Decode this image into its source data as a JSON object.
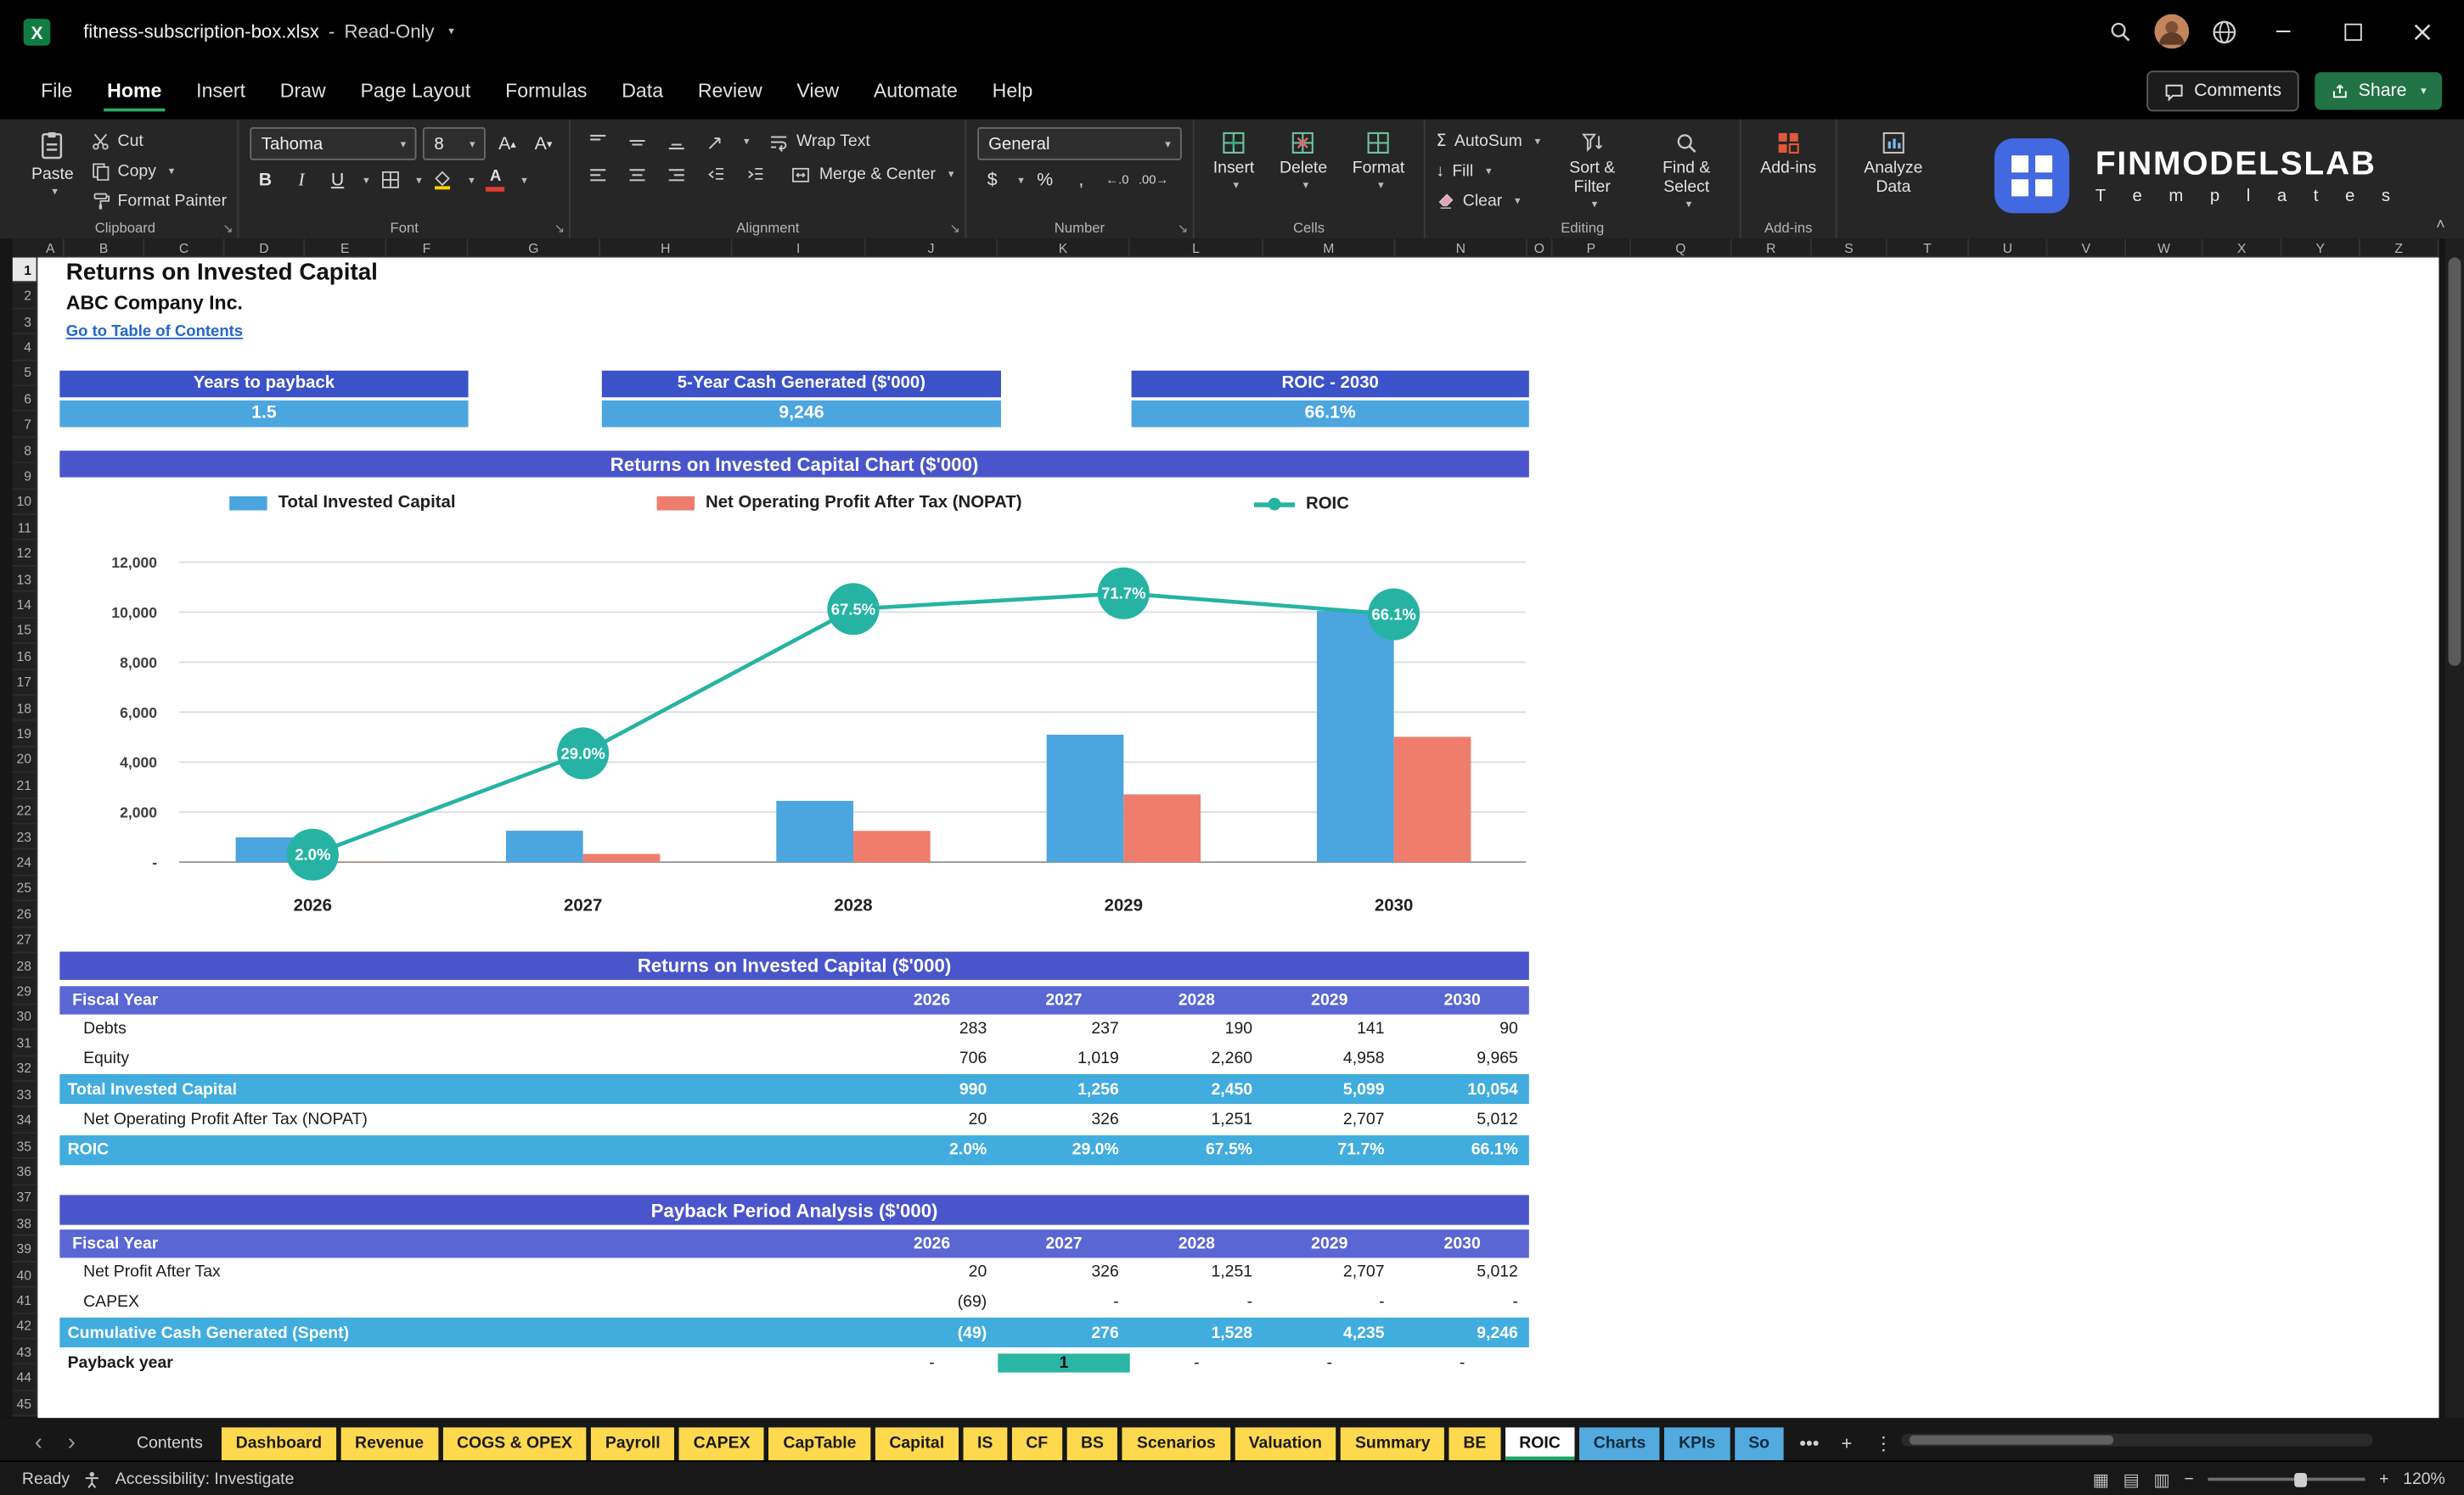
{
  "titlebar": {
    "file_name": "fitness-subscription-box.xlsx",
    "separator": "-",
    "mode": "Read-Only"
  },
  "menu": {
    "items": [
      "File",
      "Home",
      "Insert",
      "Draw",
      "Page Layout",
      "Formulas",
      "Data",
      "Review",
      "View",
      "Automate",
      "Help"
    ],
    "active": "Home",
    "comments_label": "Comments",
    "share_label": "Share"
  },
  "ribbon": {
    "clipboard": {
      "label": "Clipboard",
      "paste": "Paste",
      "cut": "Cut",
      "copy": "Copy",
      "format_painter": "Format Painter"
    },
    "font": {
      "label": "Font",
      "font_name": "Tahoma",
      "font_size": "8"
    },
    "alignment": {
      "label": "Alignment",
      "wrap_text": "Wrap Text",
      "merge_center": "Merge & Center"
    },
    "number": {
      "label": "Number",
      "format": "General",
      "dollar": "$",
      "percent": "%",
      "comma": ",",
      "inc_dec": "←.0",
      "dec_dec": ".00→"
    },
    "cells": {
      "label": "Cells",
      "insert": "Insert",
      "delete": "Delete",
      "format": "Format"
    },
    "editing": {
      "label": "Editing",
      "autosum": "AutoSum",
      "fill": "Fill",
      "clear": "Clear",
      "sort_filter": "Sort & Filter",
      "find_select": "Find & Select"
    },
    "addins": {
      "label": "Add-ins",
      "addins": "Add-ins",
      "analyze": "Analyze Data"
    },
    "brand": {
      "line1": "FINMODELSLAB",
      "line2": "T e m p l a t e s"
    }
  },
  "sheet": {
    "columns": [
      "A",
      "B",
      "C",
      "D",
      "E",
      "F",
      "G",
      "H",
      "I",
      "J",
      "K",
      "L",
      "M",
      "N",
      "O",
      "P",
      "Q",
      "R",
      "S",
      "T",
      "U",
      "V",
      "W",
      "X",
      "Y",
      "Z"
    ],
    "rows_visible": 45,
    "title": "Returns on Invested Capital",
    "company": "ABC Company Inc.",
    "link": "Go to Table of Contents",
    "chart_title": "Returns on Invested Capital Chart ($'000)",
    "kpis": [
      {
        "label": "Years to payback",
        "value": "1.5"
      },
      {
        "label": "5-Year Cash Generated ($'000)",
        "value": "9,246"
      },
      {
        "label": "ROIC - 2030",
        "value": "66.1%"
      }
    ]
  },
  "chart_data": {
    "type": "bar",
    "title": "Returns on Invested Capital Chart ($'000)",
    "categories": [
      "2026",
      "2027",
      "2028",
      "2029",
      "2030"
    ],
    "series": [
      {
        "name": "Total Invested Capital",
        "type": "bar",
        "color": "#4BA5DF",
        "values": [
          990,
          1256,
          2450,
          5099,
          10054
        ]
      },
      {
        "name": "Net Operating Profit After Tax (NOPAT)",
        "type": "bar",
        "color": "#EE7D6E",
        "values": [
          20,
          326,
          1251,
          2707,
          5012
        ]
      },
      {
        "name": "ROIC",
        "type": "line",
        "color": "#26B3A4",
        "values": [
          2.0,
          29.0,
          67.5,
          71.7,
          66.1
        ],
        "labels": [
          "2.0%",
          "29.0%",
          "67.5%",
          "71.7%",
          "66.1%"
        ]
      }
    ],
    "y_ticks": [
      "12,000",
      "10,000",
      "8,000",
      "6,000",
      "4,000",
      "2,000",
      "-"
    ],
    "value_axis_max": 12000,
    "pct_axis_max": 80,
    "ylim": [
      0,
      12000
    ],
    "grid": true,
    "legend_position": "top"
  },
  "roic_table": {
    "title": "Returns on Invested Capital ($'000)",
    "header": {
      "label": "Fiscal Year",
      "years": [
        "2026",
        "2027",
        "2028",
        "2029",
        "2030"
      ]
    },
    "rows": [
      {
        "label": "Debts",
        "indent": true,
        "style": "plain",
        "values": [
          "283",
          "237",
          "190",
          "141",
          "90"
        ]
      },
      {
        "label": "Equity",
        "indent": true,
        "style": "plain",
        "values": [
          "706",
          "1,019",
          "2,260",
          "4,958",
          "9,965"
        ]
      },
      {
        "label": "Total Invested Capital",
        "indent": false,
        "style": "highlight",
        "values": [
          "990",
          "1,256",
          "2,450",
          "5,099",
          "10,054"
        ]
      },
      {
        "label": "Net Operating Profit After Tax (NOPAT)",
        "indent": true,
        "style": "plain",
        "values": [
          "20",
          "326",
          "1,251",
          "2,707",
          "5,012"
        ]
      },
      {
        "label": "ROIC",
        "indent": false,
        "style": "highlight",
        "values": [
          "2.0%",
          "29.0%",
          "67.5%",
          "71.7%",
          "66.1%"
        ]
      }
    ]
  },
  "payback_table": {
    "title": "Payback Period Analysis ($'000)",
    "header": {
      "label": "Fiscal Year",
      "years": [
        "2026",
        "2027",
        "2028",
        "2029",
        "2030"
      ]
    },
    "rows": [
      {
        "label": "Net Profit After Tax",
        "indent": true,
        "style": "plain",
        "values": [
          "20",
          "326",
          "1,251",
          "2,707",
          "5,012"
        ]
      },
      {
        "label": "CAPEX",
        "indent": true,
        "style": "plain",
        "values": [
          "(69)",
          "-",
          "-",
          "-",
          "-"
        ]
      },
      {
        "label": "Cumulative Cash Generated (Spent)",
        "indent": false,
        "style": "highlight",
        "values": [
          "(49)",
          "276",
          "1,528",
          "4,235",
          "9,246"
        ]
      },
      {
        "label": "Payback year",
        "indent": false,
        "style": "payback",
        "highlight_col": 1,
        "values": [
          "-",
          "1",
          "-",
          "-",
          "-"
        ]
      }
    ]
  },
  "tabs": {
    "items": [
      {
        "label": "Contents",
        "type": "plain"
      },
      {
        "label": "Dashboard",
        "type": "yellow"
      },
      {
        "label": "Revenue",
        "type": "yellow"
      },
      {
        "label": "COGS & OPEX",
        "type": "yellow"
      },
      {
        "label": "Payroll",
        "type": "yellow"
      },
      {
        "label": "CAPEX",
        "type": "yellow"
      },
      {
        "label": "CapTable",
        "type": "yellow"
      },
      {
        "label": "Capital",
        "type": "yellow"
      },
      {
        "label": "IS",
        "type": "yellow"
      },
      {
        "label": "CF",
        "type": "yellow"
      },
      {
        "label": "BS",
        "type": "yellow"
      },
      {
        "label": "Scenarios",
        "type": "yellow"
      },
      {
        "label": "Valuation",
        "type": "yellow"
      },
      {
        "label": "Summary",
        "type": "yellow"
      },
      {
        "label": "BE",
        "type": "yellow"
      },
      {
        "label": "ROIC",
        "type": "active"
      },
      {
        "label": "Charts",
        "type": "blue"
      },
      {
        "label": "KPIs",
        "type": "blue"
      },
      {
        "label": "So",
        "type": "blue"
      }
    ],
    "more": "•••",
    "add": "+",
    "menu": "⋮",
    "nav_left": "‹",
    "nav_right": "›"
  },
  "statusbar": {
    "ready": "Ready",
    "accessibility": "Accessibility: Investigate",
    "zoom": "120%"
  },
  "colors": {
    "kpi_header": "#3C52C8",
    "kpi_value": "#4BA5DF",
    "section_band": "#4A55CB",
    "fiscal_row": "#5A66D4",
    "highlight_row": "#41ACDE",
    "teal": "#26B3A4",
    "salmon": "#EE7D6E",
    "bar_blue": "#4BA5DF",
    "tab_yellow": "#FFD94D",
    "tab_blue": "#52AADF",
    "share_green": "#217346",
    "link_blue": "#2467C9"
  }
}
